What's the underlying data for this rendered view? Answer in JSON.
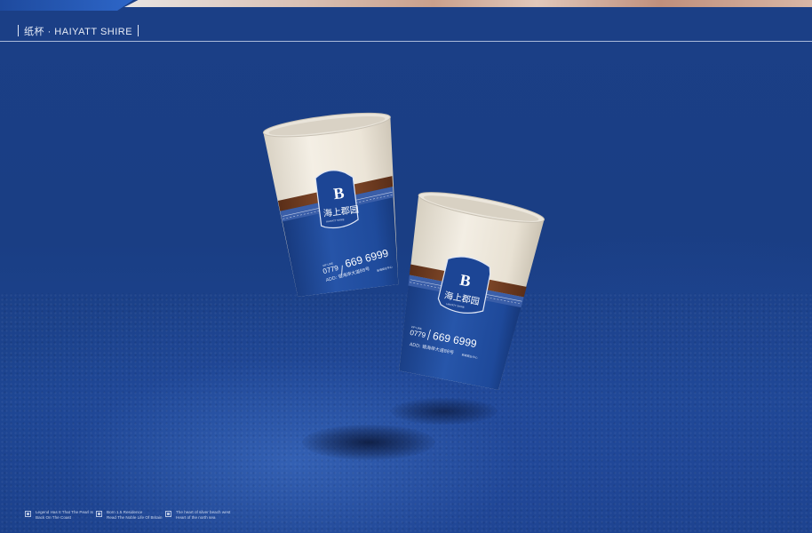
{
  "header": {
    "title_cn": "纸杯",
    "dot": "·",
    "title_en": "HAIYATT SHIRE"
  },
  "cup_print": {
    "logo_letter": "B",
    "brand_cn": "海上郡园",
    "brand_tagline": "HAIYATT SHIRE",
    "area_code": "0779",
    "phone_label": "VIP LINE",
    "phone": "669 6999",
    "address": "ADD: 银海岸大道88号",
    "address_note": "新城商业中心"
  },
  "footer": {
    "items": [
      {
        "line1": "Legend Has It That The Pearl Is",
        "line2": "Back On The Coast"
      },
      {
        "line1": "Born 1.5 Residence",
        "line2": "Read The Noble Life Of Britain"
      },
      {
        "line1": "The heart of silver beach west",
        "line2": "Heart of the north sea"
      }
    ]
  },
  "colors": {
    "background": "#1a3f86",
    "cup_blue": "#1f4a9b",
    "cup_cream": "#eee8dc",
    "band_brown": "#6b3a22",
    "accent_copper": "#c9a08c"
  }
}
